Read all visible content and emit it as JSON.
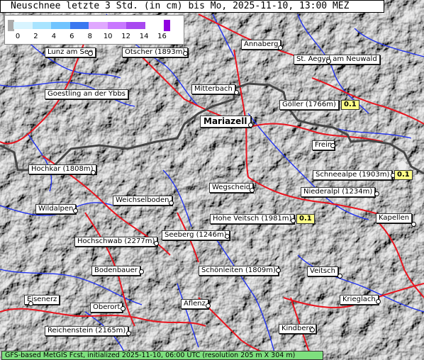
{
  "title": "Neuschnee letzte 3 Std. (in cm) bis Mo, 2025-11-10, 13:00 MEZ",
  "legend": {
    "ticks": [
      "0",
      "2",
      "4",
      "6",
      "8",
      "10",
      "12",
      "14",
      "16"
    ],
    "colors": [
      "#aaaaaa",
      "#d8f4ff",
      "#a8e4ff",
      "#70c4ff",
      "#3a78f0",
      "#e0a8ff",
      "#c878ff",
      "#a848f0",
      "#9000e0"
    ]
  },
  "places": [
    {
      "name": "Lunz am See"
    },
    {
      "name": "Ötscher (1893m)"
    },
    {
      "name": "Annaberg"
    },
    {
      "name": "St. Aegyd am Neuwald"
    },
    {
      "name": "Goestling an der Ybbs"
    },
    {
      "name": "Mitterbach"
    },
    {
      "name": "Göller (1766m)",
      "value": "0.1"
    },
    {
      "name": "Mariazell"
    },
    {
      "name": "Frein"
    },
    {
      "name": "Hochkar (1808m)"
    },
    {
      "name": "Schneealpe (1903m)",
      "value": "0.1"
    },
    {
      "name": "Wegscheid"
    },
    {
      "name": "Niederalpl (1234m)"
    },
    {
      "name": "Weichselboden"
    },
    {
      "name": "Wildalpen"
    },
    {
      "name": "Hohe Veitsch (1981m)",
      "value": "0.1"
    },
    {
      "name": "Kapellen"
    },
    {
      "name": "Seeberg (1246m)"
    },
    {
      "name": "Hochschwab (2277m)"
    },
    {
      "name": "Bodenbauer"
    },
    {
      "name": "Schönleiten (1809m)"
    },
    {
      "name": "Veitsch"
    },
    {
      "name": "Eisenerz"
    },
    {
      "name": "Aflenz"
    },
    {
      "name": "Krieglach"
    },
    {
      "name": "Oberort"
    },
    {
      "name": "Reichenstein (2165m)"
    },
    {
      "name": "Kindberg"
    }
  ],
  "footer": "GFS-based MetGIS Fcst, initialized 2025-11-10, 06:00 UTC  (resolution 205 m X 304 m)"
}
